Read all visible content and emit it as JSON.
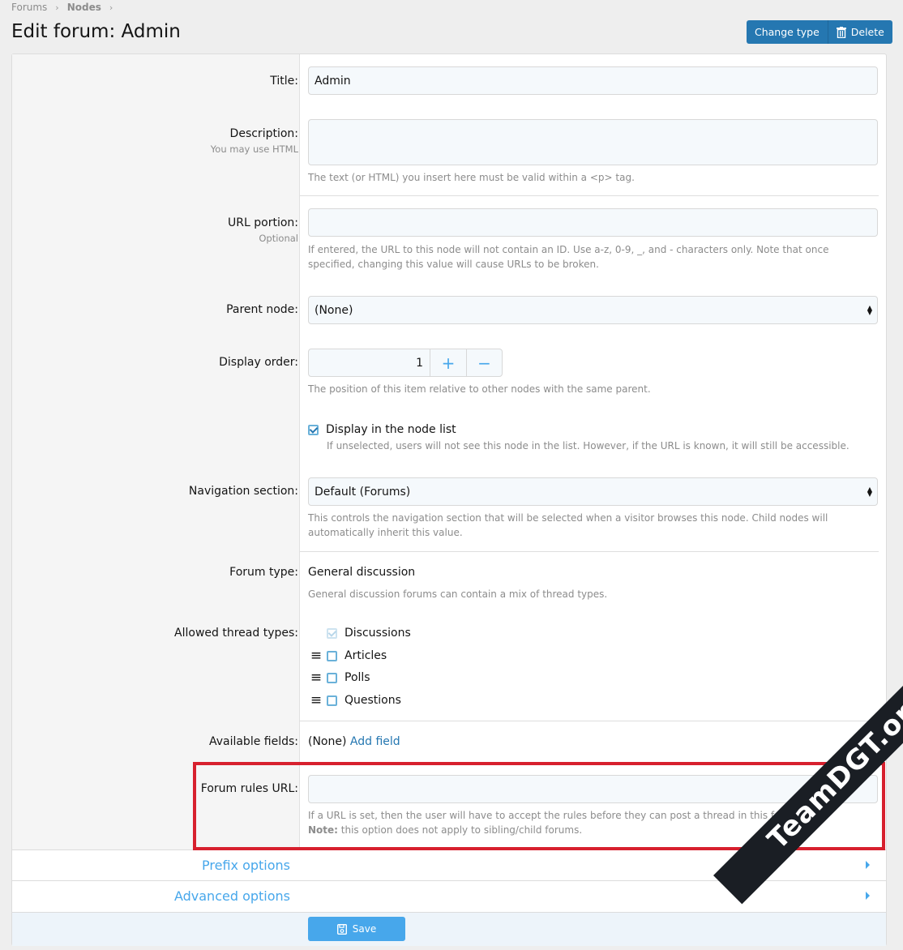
{
  "breadcrumb": [
    "Forums",
    "Nodes"
  ],
  "page_title": "Edit forum: Admin",
  "actions": {
    "change_type": "Change type",
    "delete": "Delete"
  },
  "fields": {
    "title": {
      "label": "Title:",
      "value": "Admin"
    },
    "description": {
      "label": "Description:",
      "hint": "You may use HTML",
      "value": "",
      "explain": "The text (or HTML) you insert here must be valid within a <p> tag."
    },
    "url_portion": {
      "label": "URL portion:",
      "hint": "Optional",
      "value": "",
      "explain": "If entered, the URL to this node will not contain an ID. Use a-z, 0-9, _, and - characters only. Note that once specified, changing this value will cause URLs to be broken."
    },
    "parent_node": {
      "label": "Parent node:",
      "value": "(None)"
    },
    "display_order": {
      "label": "Display order:",
      "value": "1",
      "plus": "+",
      "minus": "−",
      "explain": "The position of this item relative to other nodes with the same parent."
    },
    "display_in_list": {
      "label": "Display in the node list",
      "checked": true,
      "explain": "If unselected, users will not see this node in the list. However, if the URL is known, it will still be accessible."
    },
    "navigation_section": {
      "label": "Navigation section:",
      "value": "Default (Forums)",
      "explain": "This controls the navigation section that will be selected when a visitor browses this node. Child nodes will automatically inherit this value."
    },
    "forum_type": {
      "label": "Forum type:",
      "value": "General discussion",
      "explain": "General discussion forums can contain a mix of thread types."
    },
    "allowed_thread_types": {
      "label": "Allowed thread types:",
      "items": [
        {
          "label": "Discussions",
          "checked": true,
          "disabled": true
        },
        {
          "label": "Articles",
          "checked": false
        },
        {
          "label": "Polls",
          "checked": false
        },
        {
          "label": "Questions",
          "checked": false
        }
      ]
    },
    "available_fields": {
      "label": "Available fields:",
      "value": "(None)",
      "link": "Add field"
    },
    "forum_rules_url": {
      "label": "Forum rules URL:",
      "value": "",
      "explain": "If a URL is set, then the user will have to accept the rules before they can post a thread in this forum.",
      "note_label": "Note:",
      "note": " this option does not apply to sibling/child forums."
    }
  },
  "sections": {
    "prefix": "Prefix options",
    "advanced": "Advanced options"
  },
  "save_label": "Save",
  "watermark": "TeamDGT.org",
  "colors": {
    "primary": "#2577b1",
    "accent": "#47a7eb",
    "highlight": "#d7202e"
  }
}
